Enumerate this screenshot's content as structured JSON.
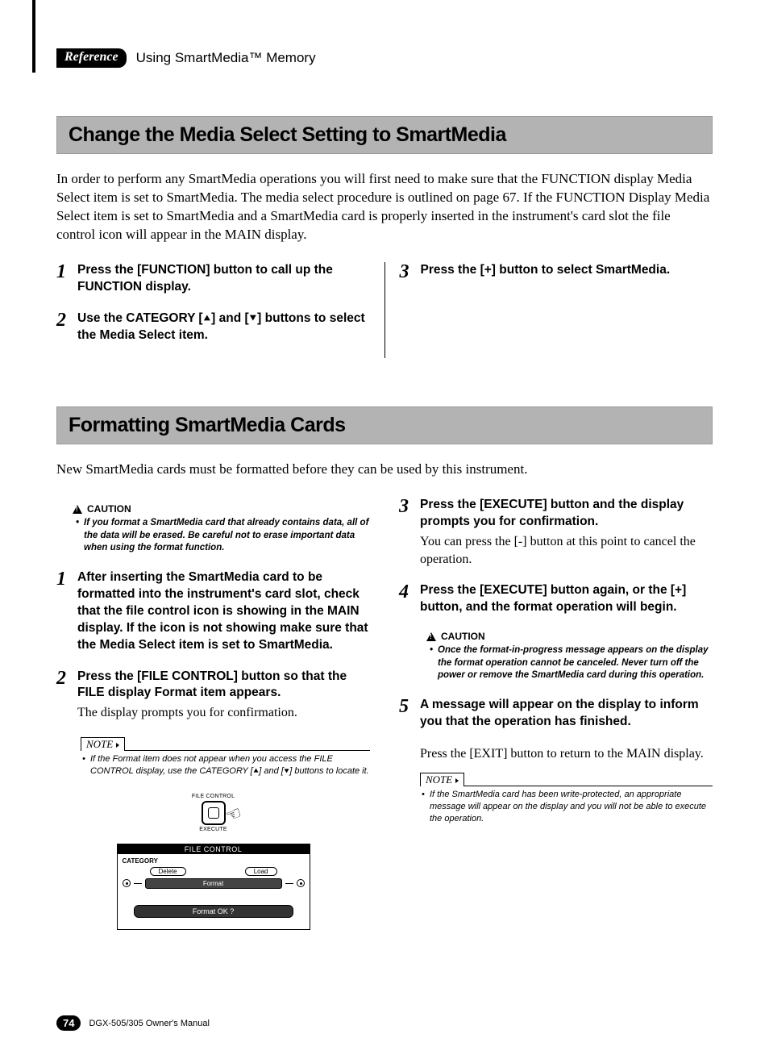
{
  "header": {
    "badge": "Reference",
    "title": "Using SmartMedia™ Memory"
  },
  "section1": {
    "title": "Change the Media Select Setting to SmartMedia",
    "intro": "In order to perform any SmartMedia operations you will first need to make sure that the FUNCTION display Media Select item is set to SmartMedia. The media select procedure is outlined on page 67. If the FUNCTION Display Media Select item is set to SmartMedia and a SmartMedia card is properly inserted in the instrument's card slot the file control icon will appear in the MAIN display.",
    "steps_left": [
      {
        "n": "1",
        "text": "Press the [FUNCTION] button to call up the FUNCTION display."
      },
      {
        "n": "2",
        "text": "Use the CATEGORY [⯅] and [⯆] buttons to select the Media Select item."
      }
    ],
    "steps_right": [
      {
        "n": "3",
        "text": "Press the [+] button to select SmartMedia."
      }
    ]
  },
  "section2": {
    "title": "Formatting SmartMedia Cards",
    "intro": "New SmartMedia cards must be formatted before they can be used by this instrument.",
    "caution1": {
      "label": "CAUTION",
      "text": "If you format a SmartMedia card that already contains data, all of the data will be erased. Be careful not to erase important data when using the format function."
    },
    "steps_left": [
      {
        "n": "1",
        "text": "After inserting the SmartMedia card to be formatted into the instrument's card slot, check that the file control icon is showing in the MAIN display. If the icon is not showing make sure that the Media Select item is set to SmartMedia."
      },
      {
        "n": "2",
        "text": "Press the [FILE CONTROL] button so that the FILE display Format item appears.",
        "sub": "The display prompts you for confirmation."
      }
    ],
    "note1": {
      "label": "NOTE",
      "text": "If the Format item does not appear when you access the FILE CONTROL display, use the CATEGORY [⯅] and [⯆] buttons to locate it."
    },
    "illus": {
      "top": "FILE CONTROL",
      "bottom": "EXECUTE"
    },
    "lcd": {
      "title": "FILE CONTROL",
      "category": "CATEGORY",
      "delete": "Delete",
      "load": "Load",
      "format": "Format",
      "prompt": "Format OK ?"
    },
    "steps_right": [
      {
        "n": "3",
        "text": "Press the [EXECUTE] button and the display prompts you for confirmation.",
        "sub": "You can press the [-] button at this point to cancel the operation."
      },
      {
        "n": "4",
        "text": "Press the [EXECUTE] button again, or the [+] button, and the format operation will begin."
      }
    ],
    "caution2": {
      "label": "CAUTION",
      "text": "Once the format-in-progress message appears on the display the format operation cannot be canceled. Never turn off the power or remove the SmartMedia card during this operation."
    },
    "step5": {
      "n": "5",
      "text": "A message will appear on the display to inform you that the operation has finished."
    },
    "after5": "Press the [EXIT] button to return to the MAIN display.",
    "note2": {
      "label": "NOTE",
      "text": "If the SmartMedia card has been write-protected, an appropriate message will appear on the display and you will not be able to execute the operation."
    }
  },
  "footer": {
    "page": "74",
    "manual": "DGX-505/305  Owner's Manual"
  }
}
